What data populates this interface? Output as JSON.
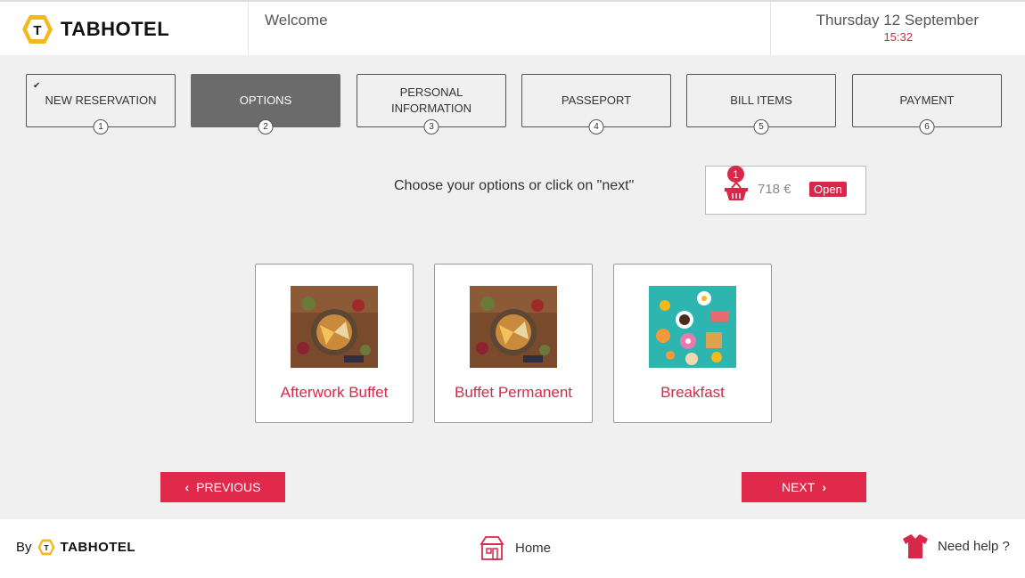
{
  "header": {
    "brand": "TABHOTEL",
    "welcome": "Welcome",
    "date": "Thursday 12 September",
    "time": "15:32"
  },
  "steps": [
    {
      "label": "NEW RESERVATION",
      "num": "1",
      "done": true
    },
    {
      "label": "OPTIONS",
      "num": "2",
      "active": true
    },
    {
      "label": "PERSONAL INFORMATION",
      "num": "3"
    },
    {
      "label": "PASSEPORT",
      "num": "4"
    },
    {
      "label": "BILL ITEMS",
      "num": "5"
    },
    {
      "label": "PAYMENT",
      "num": "6"
    }
  ],
  "prompt": "Choose your options or click on \"next\"",
  "basket": {
    "count": "1",
    "amount": "718 €",
    "status": "Open"
  },
  "options": [
    {
      "label": "Afterwork Buffet",
      "icon": "buffet-image"
    },
    {
      "label": "Buffet Permanent",
      "icon": "buffet-image"
    },
    {
      "label": "Breakfast",
      "icon": "breakfast-image"
    }
  ],
  "nav": {
    "previous": "PREVIOUS",
    "next": "NEXT"
  },
  "footer": {
    "by": "By",
    "brand": "TABHOTEL",
    "home": "Home",
    "help": "Need help ?"
  },
  "colors": {
    "accent": "#e0294b",
    "active_step": "#6b6b6b",
    "logo_yellow": "#f2b81c"
  }
}
